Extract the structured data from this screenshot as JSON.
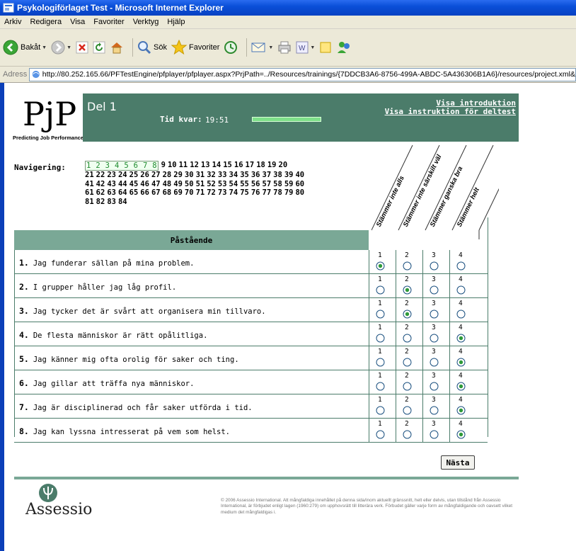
{
  "window": {
    "title": "Psykologiförlaget Test - Microsoft Internet Explorer"
  },
  "menu": [
    "Arkiv",
    "Redigera",
    "Visa",
    "Favoriter",
    "Verktyg",
    "Hjälp"
  ],
  "toolbar": {
    "back_label": "Bakåt",
    "search_label": "Sök",
    "favorites_label": "Favoriter"
  },
  "address": {
    "label": "Adress",
    "url": "http://80.252.165.66/PFTestEngine/pfplayer/pfplayer.aspx?PrjPath=../Resources/trainings/{7DDCB3A6-8756-499A-ABDC-5A436306B1A6}/resources/project.xml&"
  },
  "logo": {
    "mark": "PjP",
    "tagline": "Predicting Job Performance"
  },
  "header": {
    "part_title": "Del 1",
    "time_label": "Tid kvar:",
    "time_value": "19:51",
    "time_progress": 1.0,
    "link_intro": "Visa introduktion",
    "link_instructions": "Visa instruktion för deltest"
  },
  "navigation": {
    "label": "Navigering:",
    "done": [
      "1",
      "2",
      "3",
      "4",
      "5",
      "6",
      "7",
      "8"
    ],
    "rows": [
      [
        "9",
        "10",
        "11",
        "12",
        "13",
        "14",
        "15",
        "16",
        "17",
        "18",
        "19",
        "20"
      ],
      [
        "21",
        "22",
        "23",
        "24",
        "25",
        "26",
        "27",
        "28",
        "29",
        "30",
        "31",
        "32",
        "33",
        "34",
        "35",
        "36",
        "37",
        "38",
        "39",
        "40"
      ],
      [
        "41",
        "42",
        "43",
        "44",
        "45",
        "46",
        "47",
        "48",
        "49",
        "50",
        "51",
        "52",
        "53",
        "54",
        "55",
        "56",
        "57",
        "58",
        "59",
        "60"
      ],
      [
        "61",
        "62",
        "63",
        "64",
        "65",
        "66",
        "67",
        "68",
        "69",
        "70",
        "71",
        "72",
        "73",
        "74",
        "75",
        "76",
        "77",
        "78",
        "79",
        "80"
      ],
      [
        "81",
        "82",
        "83",
        "84"
      ]
    ]
  },
  "scale": {
    "options": [
      "Stämmer inte alls",
      "Stämmer inte särskilt väl",
      "Stämmer ganska bra",
      "Stämmer helt"
    ],
    "numbers": [
      "1",
      "2",
      "3",
      "4"
    ]
  },
  "table": {
    "header": "Påstående",
    "questions": [
      {
        "num": "1.",
        "text": "Jag funderar sällan på mina problem.",
        "selected": 1
      },
      {
        "num": "2.",
        "text": "I grupper håller jag låg profil.",
        "selected": 2
      },
      {
        "num": "3.",
        "text": "Jag tycker det är svårt att organisera min tillvaro.",
        "selected": 2
      },
      {
        "num": "4.",
        "text": "De flesta människor är rätt opålitliga.",
        "selected": 4
      },
      {
        "num": "5.",
        "text": "Jag känner mig ofta orolig för saker och ting.",
        "selected": 4
      },
      {
        "num": "6.",
        "text": "Jag gillar att träffa nya människor.",
        "selected": 4
      },
      {
        "num": "7.",
        "text": "Jag är disciplinerad och får saker utförda i tid.",
        "selected": 4
      },
      {
        "num": "8.",
        "text": "Jag kan lyssna intresserat på vem som helst.",
        "selected": 4
      }
    ]
  },
  "next_button": "Nästa",
  "footer": {
    "brand": "Assessio",
    "copyright": "© 2006 Assessio International. Att mångfaldiga innehållet på denna sida/inom aktuellt gränssnitt, helt eller delvis, utan tillstånd från Assessio International, är förbjudet enligt lagen (1960:279) om upphovsrätt till litterära verk. Förbudet gäller varje form av mångfaldigande och oavsett vilket medium det mångfaldigas i."
  },
  "colors": {
    "header_band": "#4b7c6a",
    "table_header": "#7aa896",
    "nav_done": "#1e8a2e",
    "radio_selected": "#2e9a3a"
  }
}
